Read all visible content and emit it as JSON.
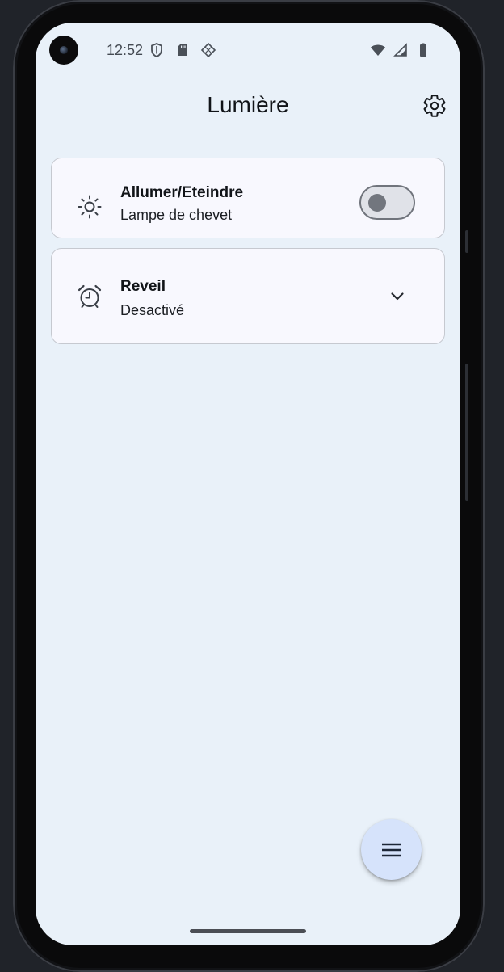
{
  "status_bar": {
    "time": "12:52",
    "left_icons": [
      "shield-icon",
      "sd-card-icon",
      "diamond-grid-icon"
    ],
    "right_icons": [
      "wifi-icon",
      "cell-signal-icon",
      "battery-icon"
    ]
  },
  "app_bar": {
    "title": "Lumière",
    "action_icon": "settings-gear-icon"
  },
  "cards": [
    {
      "icon": "brightness-icon",
      "title": "Allumer/Eteindre",
      "subtitle": "Lampe de chevet",
      "control": "switch",
      "switch_on": false
    },
    {
      "icon": "alarm-clock-icon",
      "title": "Reveil",
      "subtitle": "Desactivé",
      "control": "expand-chevron"
    }
  ],
  "fab": {
    "icon": "menu-icon"
  },
  "colors": {
    "screen_background": "#e9f1f9",
    "card_background": "#f8f8fe",
    "card_border": "#c6c9d0",
    "fab_background": "#d6e3fb",
    "switch_track": "#e0e2e8",
    "switch_outline": "#70747c",
    "text_primary": "#111418"
  }
}
